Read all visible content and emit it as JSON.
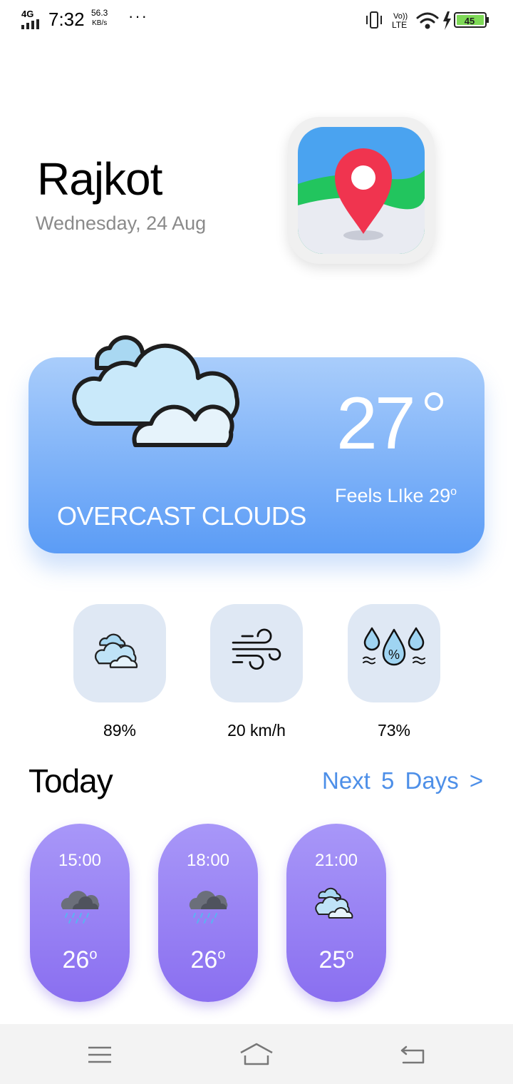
{
  "status_bar": {
    "network": "4G",
    "time": "7:32",
    "speed": "56.3",
    "speed_unit": "KB/s",
    "volte": "Vo))",
    "lte": "LTE",
    "battery": "45"
  },
  "location": {
    "city": "Rajkot",
    "date": "Wednesday, 24 Aug"
  },
  "current": {
    "temperature": "27",
    "feels_like": "Feels LIke 29",
    "condition": "OVERCAST CLOUDS"
  },
  "metrics": [
    {
      "icon": "clouds-icon",
      "value": "89%"
    },
    {
      "icon": "wind-icon",
      "value": "20 km/h"
    },
    {
      "icon": "humidity-icon",
      "value": "73%"
    }
  ],
  "forecast": {
    "title": "Today",
    "next_link": "Next  5  Days  >",
    "hours": [
      {
        "time": "15:00",
        "icon": "rain-cloud-icon",
        "temp": "26"
      },
      {
        "time": "18:00",
        "icon": "rain-cloud-icon",
        "temp": "26"
      },
      {
        "time": "21:00",
        "icon": "clouds-icon",
        "temp": "25"
      }
    ]
  },
  "colors": {
    "card_top": "#a9cdfb",
    "card_bottom": "#5b9cf6",
    "pill_top": "#a897f8",
    "pill_bottom": "#8a6ff0",
    "link": "#4d8fe8"
  }
}
